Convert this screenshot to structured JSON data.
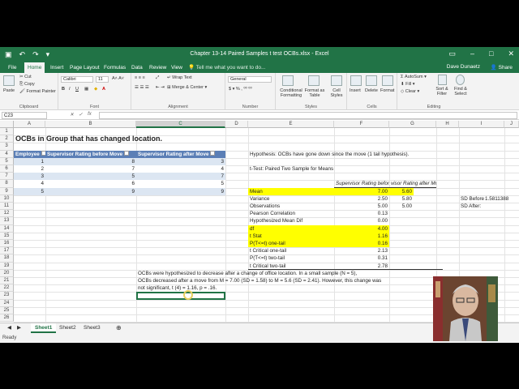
{
  "window": {
    "title": "Chapter 13-14 Paired Samples t test OCBs.xlsx - Excel",
    "user": "Dave Dunaetz",
    "share": "Share",
    "tell_me": "Tell me what you want to do..."
  },
  "ribbon_tabs": [
    "File",
    "Home",
    "Insert",
    "Page Layout",
    "Formulas",
    "Data",
    "Review",
    "View"
  ],
  "ribbon": {
    "clipboard": {
      "label": "Clipboard",
      "paste": "Paste",
      "cut": "Cut",
      "copy": "Copy",
      "format_painter": "Format Painter"
    },
    "font": {
      "label": "Font",
      "name": "Calibri",
      "size": "11"
    },
    "alignment": {
      "label": "Alignment",
      "wrap": "Wrap Text",
      "merge": "Merge & Center"
    },
    "number": {
      "label": "Number",
      "format": "General"
    },
    "styles": {
      "label": "Styles",
      "conditional": "Conditional Formatting",
      "format_table": "Format as Table",
      "cell_styles": "Cell Styles"
    },
    "cells": {
      "label": "Cells",
      "insert": "Insert",
      "delete": "Delete",
      "format": "Format"
    },
    "editing": {
      "label": "Editing",
      "autosum": "AutoSum",
      "fill": "Fill",
      "clear": "Clear",
      "sort": "Sort & Filter",
      "find": "Find & Select"
    }
  },
  "formula_bar": {
    "name_box": "C23",
    "content": ""
  },
  "columns": [
    "A",
    "B",
    "C",
    "D",
    "E",
    "F",
    "G",
    "H",
    "I",
    "J"
  ],
  "rows": [
    "1",
    "2",
    "3",
    "4",
    "5",
    "6",
    "7",
    "8",
    "9",
    "10",
    "11",
    "12",
    "13",
    "14",
    "15",
    "16",
    "17",
    "18",
    "19",
    "20",
    "21",
    "22",
    "23",
    "24",
    "25",
    "26"
  ],
  "sheet": {
    "title": "OCBs in Group that has changed location.",
    "table_headers": [
      "Employee",
      "Supervisor Rating before Move",
      "Supervisor Rating after Move"
    ],
    "table_rows": [
      [
        "1",
        "8",
        "3"
      ],
      [
        "2",
        "7",
        "4"
      ],
      [
        "3",
        "5",
        "7"
      ],
      [
        "4",
        "6",
        "5"
      ],
      [
        "5",
        "9",
        "9"
      ]
    ],
    "hypothesis": "Hypothesis: OCBs have gone down since the move (1 tail hypothesis).",
    "ttest_title": "t-Test: Paired Two Sample for Means",
    "ttest_col1": "Supervisor Rating before Move",
    "ttest_col2": "visor Rating after Move",
    "ttest_rows": [
      {
        "label": "Mean",
        "v1": "7.00",
        "v2": "5.60",
        "yellow": true
      },
      {
        "label": "Variance",
        "v1": "2.50",
        "v2": "5.80",
        "yellow": false
      },
      {
        "label": "Observations",
        "v1": "5.00",
        "v2": "5.00",
        "yellow": false
      },
      {
        "label": "Pearson Correlation",
        "v1": "0.13",
        "v2": "",
        "yellow": false
      },
      {
        "label": "Hypothesized Mean Dif",
        "v1": "0.00",
        "v2": "",
        "yellow": false
      },
      {
        "label": "df",
        "v1": "4.00",
        "v2": "",
        "yellow": true
      },
      {
        "label": "t Stat",
        "v1": "1.16",
        "v2": "",
        "yellow": true
      },
      {
        "label": "P(T<=t) one-tail",
        "v1": "0.16",
        "v2": "",
        "yellow": true
      },
      {
        "label": "t Critical one-tail",
        "v1": "2.13",
        "v2": "",
        "yellow": false
      },
      {
        "label": "P(T<=t) two-tail",
        "v1": "0.31",
        "v2": "",
        "yellow": false
      },
      {
        "label": "t Critical two-tail",
        "v1": "2.78",
        "v2": "",
        "yellow": false
      }
    ],
    "sd_before": "SD Before",
    "sd_before_val": "1.5811388",
    "sd_after": "SD After:",
    "summary": [
      "OCBs were hypothesized to decrease after a change of office location. In a small sample (N = 5),",
      "OCBs decreased after a move from M = 7.00 (SD = 1.58) to M = 5.6 (SD = 2.41). However, this change was",
      "not significant, t (4) = 1.16, p = .16."
    ]
  },
  "sheet_tabs": [
    "Sheet1",
    "Sheet2",
    "Sheet3"
  ],
  "status": "Ready",
  "colors": {
    "excel_green": "#217346",
    "highlight": "#ffff00",
    "table_header": "#5b7fb6",
    "band": "#dce6f2"
  }
}
